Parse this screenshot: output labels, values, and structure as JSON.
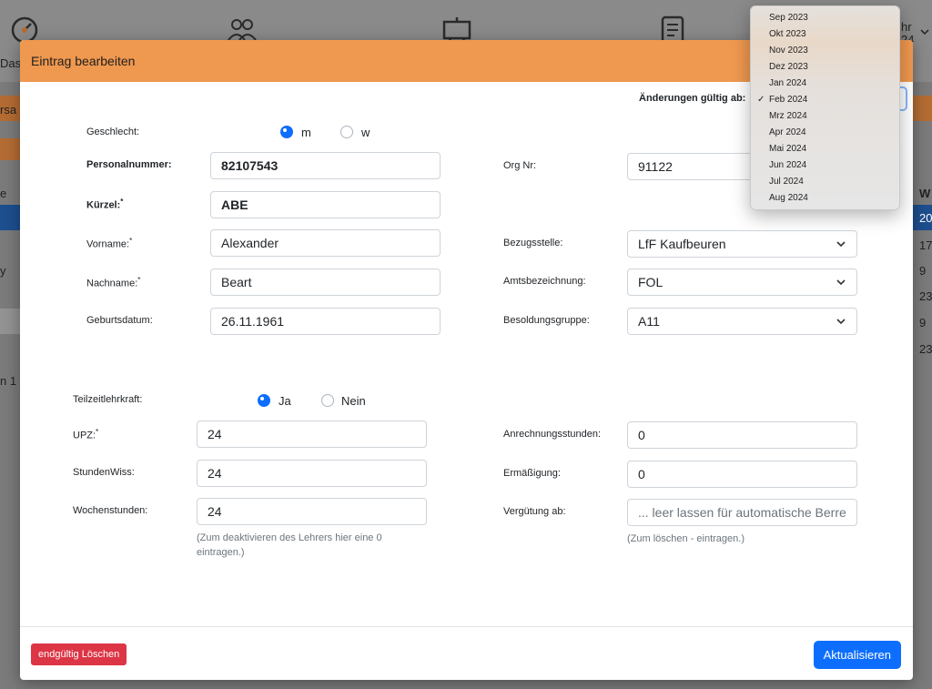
{
  "background": {
    "nav_dash_text": "Dash",
    "nav_year_text_top": "hr",
    "nav_year_text_bottom": "24",
    "left_tab_text": "rsa",
    "left_sort_text": "e",
    "left_row_text": "y",
    "left_pagination_text": "n 1 b",
    "right_col_header": "W",
    "right_col_values": [
      "20",
      "17",
      "9",
      "23",
      "9",
      "23"
    ]
  },
  "modal": {
    "title": "Eintrag bearbeiten",
    "changes_label": "Änderungen gültig ab:",
    "gender": {
      "label": "Geschlecht:",
      "options": [
        "m",
        "w"
      ],
      "selected": "m"
    },
    "personal_number": {
      "label": "Personalnummer:",
      "value": "82107543"
    },
    "short": {
      "label": "Kürzel:",
      "required": "*",
      "value": "ABE"
    },
    "first_name": {
      "label": "Vorname:",
      "required": "*",
      "value": "Alexander"
    },
    "last_name": {
      "label": "Nachname:",
      "required": "*",
      "value": "Beart"
    },
    "birthdate": {
      "label": "Geburtsdatum:",
      "value": "26.11.1961"
    },
    "org_nr": {
      "label": "Org Nr:",
      "value": "91122"
    },
    "reference": {
      "label": "Bezugsstelle:",
      "value": "LfF Kaufbeuren"
    },
    "title_official": {
      "label": "Amtsbezeichnung:",
      "value": "FOL"
    },
    "salary_group": {
      "label": "Besoldungsgruppe:",
      "value": "A11"
    },
    "parttime": {
      "label": "Teilzeitlehrkraft:",
      "options": [
        "Ja",
        "Nein"
      ],
      "selected": "Ja"
    },
    "upz": {
      "label": "UPZ:",
      "required": "*",
      "value": "24"
    },
    "hours_wiss": {
      "label": "StundenWiss:",
      "value": "24"
    },
    "weekly_hours": {
      "label": "Wochenstunden:",
      "value": "24",
      "hint": "(Zum deaktivieren des Lehrers hier eine 0 eintragen.)"
    },
    "credit_hours": {
      "label": "Anrechnungsstunden:",
      "value": "0"
    },
    "reduction": {
      "label": "Ermäßigung:",
      "value": "0"
    },
    "payment_from": {
      "label": "Vergütung ab:",
      "placeholder": "... leer lassen für automatische Berre",
      "hint": "(Zum löschen - eintragen.)"
    },
    "delete_button": "endgültig Löschen",
    "update_button": "Aktualisieren"
  },
  "dropdown": {
    "options": [
      "Sep 2023",
      "Okt 2023",
      "Nov 2023",
      "Dez 2023",
      "Jan 2024",
      "Feb 2024",
      "Mrz 2024",
      "Apr 2024",
      "Mai 2024",
      "Jun 2024",
      "Jul 2024",
      "Aug 2024"
    ],
    "selected_index": 5,
    "check_mark": "✓"
  },
  "colors": {
    "header": "#ef984f",
    "primary": "#0d6efd",
    "danger": "#dc3545"
  }
}
